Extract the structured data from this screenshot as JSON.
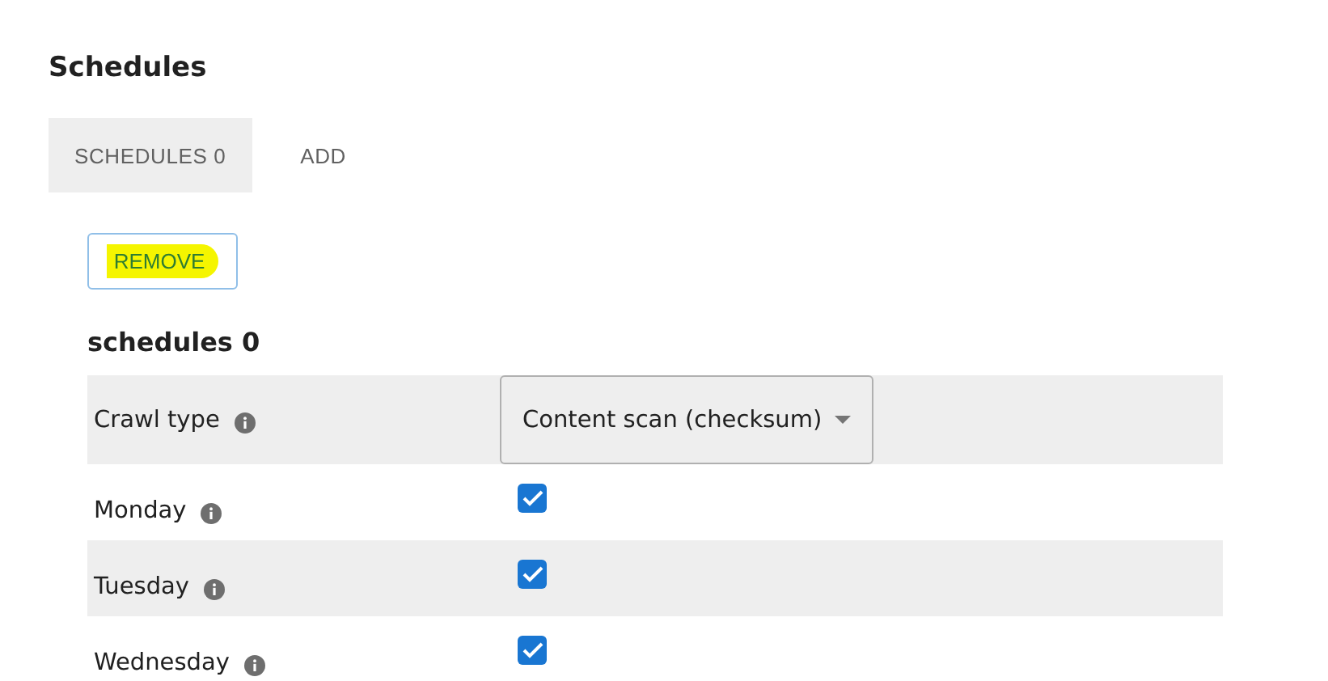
{
  "heading": "Schedules",
  "tabs": [
    {
      "label": "SCHEDULES 0",
      "selected": true
    },
    {
      "label": "ADD",
      "selected": false
    }
  ],
  "remove_button": {
    "label": "REMOVE",
    "highlighted": true
  },
  "section_title": "schedules 0",
  "rows": [
    {
      "kind": "select",
      "label": "Crawl type",
      "value": "Content scan (checksum)"
    },
    {
      "kind": "checkbox",
      "label": "Monday",
      "checked": true
    },
    {
      "kind": "checkbox",
      "label": "Tuesday",
      "checked": true
    },
    {
      "kind": "checkbox",
      "label": "Wednesday",
      "checked": true
    }
  ]
}
